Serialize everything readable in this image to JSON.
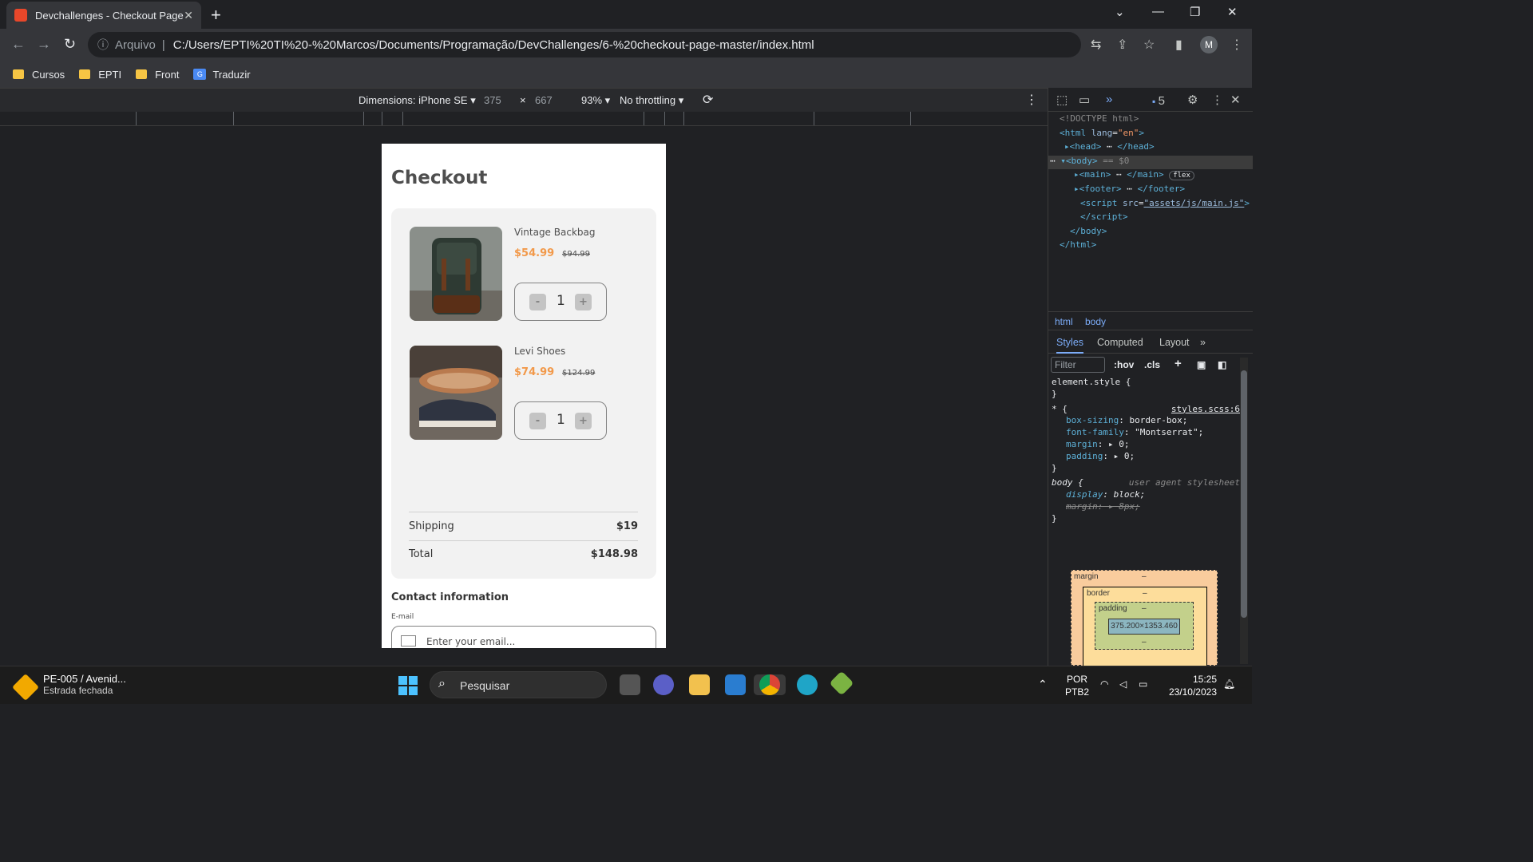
{
  "browser": {
    "tab_title": "Devchallenges - Checkout Page",
    "tab_close": "✕",
    "new_tab": "+",
    "address_prefix": "Arquivo",
    "url": "C:/Users/EPTI%20TI%20-%20Marcos/Documents/Programação/DevChallenges/6-%20checkout-page-master/index.html",
    "profile_initial": "M",
    "bookmarks": [
      "Cursos",
      "EPTI",
      "Front",
      "Traduzir"
    ]
  },
  "device_toolbar": {
    "dimensions_label": "Dimensions: iPhone SE",
    "width": "375",
    "times": "×",
    "height": "667",
    "zoom": "93%",
    "throttling": "No throttling"
  },
  "checkout": {
    "title": "Checkout",
    "products": [
      {
        "name": "Vintage Backbag",
        "price": "$54.99",
        "old_price": "$94.99",
        "qty": "1"
      },
      {
        "name": "Levi Shoes",
        "price": "$74.99",
        "old_price": "$124.99",
        "qty": "1"
      }
    ],
    "minus": "-",
    "plus": "+",
    "shipping_label": "Shipping",
    "shipping_value": "$19",
    "total_label": "Total",
    "total_value": "$148.98",
    "contact_title": "Contact information",
    "email_label": "E-mail",
    "email_placeholder": "Enter your email..."
  },
  "devtools": {
    "issues_count": "5",
    "breadcrumbs": [
      "html",
      "body"
    ],
    "style_tabs": [
      "Styles",
      "Computed",
      "Layout"
    ],
    "filter_placeholder": "Filter",
    "hov": ":hov",
    "cls": ".cls",
    "rule_source": "styles.scss:6",
    "ua_source": "user agent stylesheet",
    "box": {
      "margin": "margin",
      "border": "border",
      "padding": "padding",
      "content": "375.200×1353.460",
      "dash": "–"
    }
  },
  "taskbar": {
    "weather_title": "PE-005 / Avenid...",
    "weather_sub": "Estrada fechada",
    "search": "Pesquisar",
    "lang1": "POR",
    "lang2": "PTB2",
    "time": "15:25",
    "date": "23/10/2023"
  }
}
